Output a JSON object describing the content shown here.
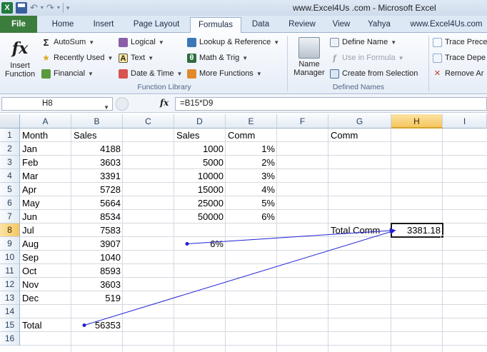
{
  "window": {
    "title": "www.Excel4Us .com  -  Microsoft Excel"
  },
  "quick_access": {
    "app_icon": "X"
  },
  "tabs": [
    {
      "label": "File"
    },
    {
      "label": "Home"
    },
    {
      "label": "Insert"
    },
    {
      "label": "Page Layout"
    },
    {
      "label": "Formulas"
    },
    {
      "label": "Data"
    },
    {
      "label": "Review"
    },
    {
      "label": "View"
    },
    {
      "label": "Yahya"
    },
    {
      "label": "www.Excel4Us.com"
    }
  ],
  "ribbon": {
    "insert_function": {
      "icon_text": "fx",
      "label_line1": "Insert",
      "label_line2": "Function"
    },
    "function_library": {
      "label": "Function Library",
      "buttons": [
        {
          "label": "AutoSum",
          "icon": "sigma-icon",
          "glyph": "Σ"
        },
        {
          "label": "Recently Used",
          "icon": "star-icon",
          "glyph": "★"
        },
        {
          "label": "Financial",
          "icon": "book-icon",
          "glyph": ""
        },
        {
          "label": "Logical",
          "icon": "book-icon",
          "glyph": ""
        },
        {
          "label": "Text",
          "icon": "text-icon",
          "glyph": "A"
        },
        {
          "label": "Date & Time",
          "icon": "calendar-icon",
          "glyph": ""
        },
        {
          "label": "Lookup & Reference",
          "icon": "book-icon",
          "glyph": ""
        },
        {
          "label": "Math & Trig",
          "icon": "theta-icon",
          "glyph": "θ"
        },
        {
          "label": "More Functions",
          "icon": "book-icon",
          "glyph": ""
        }
      ]
    },
    "defined_names": {
      "label": "Defined Names",
      "name_manager": {
        "label_line1": "Name",
        "label_line2": "Manager"
      },
      "define_name": "Define Name",
      "use_in_formula": "Use in Formula",
      "create_from_selection": "Create from Selection"
    },
    "formula_auditing": {
      "trace_precedents": "Trace Prece",
      "trace_dependents": "Trace Depe",
      "remove_arrows": "Remove Ar"
    }
  },
  "formula_bar": {
    "name_box": "H8",
    "fx": "fx",
    "formula": "=B15*D9"
  },
  "columns": [
    "A",
    "B",
    "C",
    "D",
    "E",
    "F",
    "G",
    "H",
    "I"
  ],
  "selected_column": "H",
  "rows": [
    "1",
    "2",
    "3",
    "4",
    "5",
    "6",
    "7",
    "8",
    "9",
    "10",
    "11",
    "12",
    "13",
    "14",
    "15",
    "16"
  ],
  "selected_row": "8",
  "sheet": {
    "A": [
      "Month",
      "Jan",
      "Feb",
      "Mar",
      "Apr",
      "May",
      "Jun",
      "Jul",
      "Aug",
      "Sep",
      "Oct",
      "Nov",
      "Dec",
      "",
      "Total",
      ""
    ],
    "B": [
      "Sales",
      "4188",
      "3603",
      "3391",
      "5728",
      "5664",
      "8534",
      "7583",
      "3907",
      "1040",
      "8593",
      "3603",
      "519",
      "",
      "56353",
      ""
    ],
    "D": [
      "Sales",
      "1000",
      "5000",
      "10000",
      "15000",
      "25000",
      "50000",
      "",
      "6%",
      "",
      "",
      "",
      "",
      "",
      "",
      ""
    ],
    "E": [
      "Comm",
      "1%",
      "2%",
      "3%",
      "4%",
      "5%",
      "6%",
      "",
      "",
      "",
      "",
      "",
      "",
      "",
      "",
      ""
    ],
    "G1": "Comm",
    "G8": "Total Comm",
    "H8": "3381.18"
  },
  "colors": {
    "file_tab": "#3b7d3c",
    "trace_arrow": "#1f1fd6",
    "selection_header": "#f6c65f"
  }
}
